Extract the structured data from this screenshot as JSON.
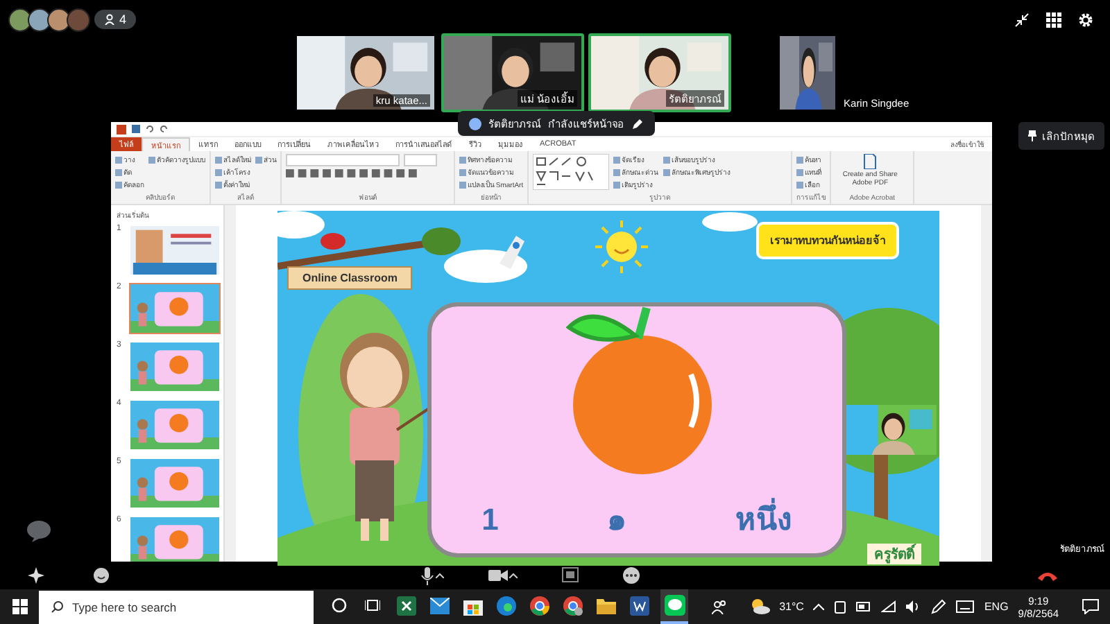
{
  "meeting": {
    "participant_count": "4",
    "avatars": [
      {
        "color": "#7d9a5e"
      },
      {
        "color": "#8aa4b8"
      },
      {
        "color": "#b98f6e"
      },
      {
        "color": "#6e4a3a"
      }
    ],
    "tiles": [
      {
        "name": "kru katae...",
        "speaking": false,
        "kind": "tile"
      },
      {
        "name": "แม่ น้องเอิ้ม",
        "speaking": true,
        "kind": "tile"
      },
      {
        "name": "รัตติยาภรณ์",
        "speaking": true,
        "kind": "tile"
      },
      {
        "name": "Karin Singdee",
        "speaking": false,
        "kind": "compact"
      }
    ],
    "share_banner": {
      "name": "รัตติยาภรณ์",
      "text": "กำลังแชร์หน้าจอ"
    },
    "pin_button": "เลิกปักหมุด",
    "presenter_label": "รัตติยาภรณ์"
  },
  "powerpoint": {
    "sign_in": "ลงชื่อเข้าใช้",
    "tabs": [
      {
        "label": "ไฟล์",
        "selected": false,
        "kind": "backstage"
      },
      {
        "label": "หน้าแรก",
        "selected": true,
        "kind": "tab"
      },
      {
        "label": "แทรก",
        "selected": false,
        "kind": "tab"
      },
      {
        "label": "ออกแบบ",
        "selected": false,
        "kind": "tab"
      },
      {
        "label": "การเปลี่ยน",
        "selected": false,
        "kind": "tab"
      },
      {
        "label": "ภาพเคลื่อนไหว",
        "selected": false,
        "kind": "tab"
      },
      {
        "label": "การนำเสนอสไลด์",
        "selected": false,
        "kind": "tab"
      },
      {
        "label": "รีวิว",
        "selected": false,
        "kind": "tab"
      },
      {
        "label": "มุมมอง",
        "selected": false,
        "kind": "tab"
      },
      {
        "label": "ACROBAT",
        "selected": false,
        "kind": "tab"
      }
    ],
    "ribbon_groups": [
      {
        "label": "คลิปบอร์ด",
        "kind": "buttons",
        "buttons": [
          "วาง",
          "ตัด",
          "คัดลอก",
          "ตัวคัดวางรูปแบบ"
        ]
      },
      {
        "label": "สไลด์",
        "kind": "buttons",
        "buttons": [
          "สไลด์ใหม่",
          "เค้าโครง",
          "ตั้งค่าใหม่",
          "ส่วน"
        ]
      },
      {
        "label": "ฟอนต์",
        "kind": "font"
      },
      {
        "label": "ย่อหน้า",
        "kind": "buttons",
        "buttons": [
          "ทิศทางข้อความ",
          "จัดแนวข้อความ",
          "แปลงเป็น SmartArt"
        ]
      },
      {
        "label": "รูปวาด",
        "kind": "shapes",
        "buttons": [
          "จัดเรียง",
          "ลักษณะด่วน",
          "เติมรูปร่าง",
          "เส้นขอบรูปร่าง",
          "ลักษณะพิเศษรูปร่าง"
        ]
      },
      {
        "label": "การแก้ไข",
        "kind": "buttons",
        "buttons": [
          "ค้นหา",
          "แทนที่",
          "เลือก"
        ]
      },
      {
        "label": "Adobe Acrobat",
        "kind": "pdf",
        "buttons": [
          "Create and Share Adobe PDF"
        ]
      }
    ],
    "section": "ส่วนเริ่มต้น",
    "slides": [
      {
        "number": "1",
        "selected": false,
        "kind": "title"
      },
      {
        "number": "2",
        "selected": true,
        "kind": "oranges"
      },
      {
        "number": "3",
        "selected": false,
        "kind": "oranges"
      },
      {
        "number": "4",
        "selected": false,
        "kind": "oranges"
      },
      {
        "number": "5",
        "selected": false,
        "kind": "oranges"
      },
      {
        "number": "6",
        "selected": false,
        "kind": "oranges"
      }
    ]
  },
  "slide": {
    "sign": "Online Classroom",
    "bubble": "เรามาทบทวนกันหน่อยจ้า",
    "words": [
      "1",
      "๑",
      "หนึ่ง"
    ],
    "name_tag": "ครูรัตติ์"
  },
  "taskbar": {
    "search_placeholder": "Type here to search",
    "weather": "31°C",
    "language": "ENG",
    "time": "9:19",
    "date": "9/8/2564"
  }
}
